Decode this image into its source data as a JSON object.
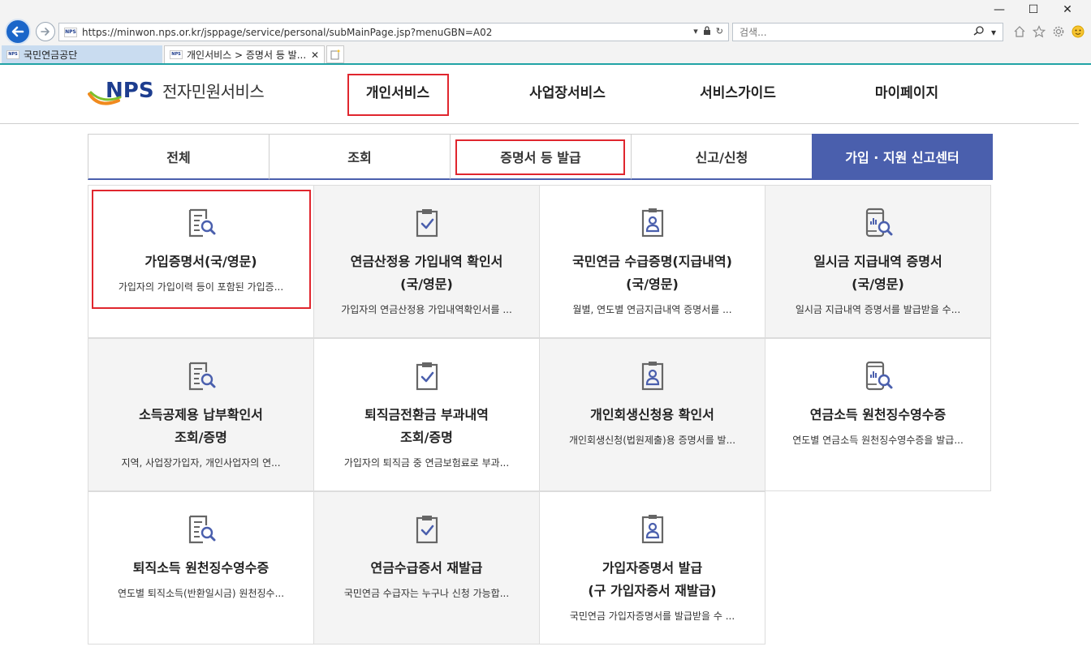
{
  "browser": {
    "url": "https://minwon.nps.or.kr/jsppage/service/personal/subMainPage.jsp?menuGBN=A02",
    "search_placeholder": "검색...",
    "tabs": [
      {
        "label": "국민연금공단"
      },
      {
        "label": "개인서비스 > 증명서 등 발..."
      }
    ],
    "tab_close": "✕",
    "favicon_text": "NPS"
  },
  "site": {
    "logo_mark": "NPS",
    "logo_text": "전자민원서비스",
    "gnb": [
      {
        "label": "개인서비스"
      },
      {
        "label": "사업장서비스"
      },
      {
        "label": "서비스가이드"
      },
      {
        "label": "마이페이지"
      }
    ]
  },
  "subtabs": [
    {
      "label": "전체"
    },
    {
      "label": "조회"
    },
    {
      "label": "증명서 등 발급"
    },
    {
      "label": "신고/신청"
    },
    {
      "label": "가입 · 지원 신고센터"
    }
  ],
  "cards": [
    {
      "icon": "document-search-icon",
      "title": "가입증명서(국/영문)",
      "desc": "가입자의 가입이력 등이 포함된 가입증..."
    },
    {
      "icon": "clipboard-check-icon",
      "title": "연금산정용 가입내역 확인서\n(국/영문)",
      "desc": "가입자의 연금산정용 가입내역확인서를 ..."
    },
    {
      "icon": "person-badge-icon",
      "title": "국민연금 수급증명(지급내역)\n(국/영문)",
      "desc": "월별, 연도별 연금지급내역 증명서를 ..."
    },
    {
      "icon": "phone-chart-search-icon",
      "title": "일시금 지급내역 증명서\n(국/영문)",
      "desc": "일시금 지급내역 증명서를 발급받을 수..."
    },
    {
      "icon": "document-search-icon",
      "title": "소득공제용 납부확인서\n조회/증명",
      "desc": "지역, 사업장가입자, 개인사업자의 연..."
    },
    {
      "icon": "clipboard-check-icon",
      "title": "퇴직금전환금 부과내역\n조회/증명",
      "desc": "가입자의 퇴직금 중 연금보험료로 부과..."
    },
    {
      "icon": "person-badge-icon",
      "title": "개인회생신청용 확인서",
      "desc": "개인회생신청(법원제출)용 증명서를 발..."
    },
    {
      "icon": "phone-chart-search-icon",
      "title": "연금소득 원천징수영수증",
      "desc": "연도별 연금소득 원천징수영수증을 발급..."
    },
    {
      "icon": "document-search-icon",
      "title": "퇴직소득 원천징수영수증",
      "desc": "연도별 퇴직소득(반환일시금) 원천징수..."
    },
    {
      "icon": "clipboard-check-icon",
      "title": "연금수급증서 재발급",
      "desc": "국민연금 수급자는 누구나 신청 가능합..."
    },
    {
      "icon": "person-badge-icon",
      "title": "가입자증명서 발급\n(구 가입자증서 재발급)",
      "desc": "국민연금 가입자증명서를 발급받을 수 ..."
    }
  ],
  "colors": {
    "accent": "#4a5fad",
    "highlight": "#e0262e",
    "teal_bar": "#21a3a6",
    "icon_gray": "#666666",
    "icon_blue": "#4a5fad"
  }
}
